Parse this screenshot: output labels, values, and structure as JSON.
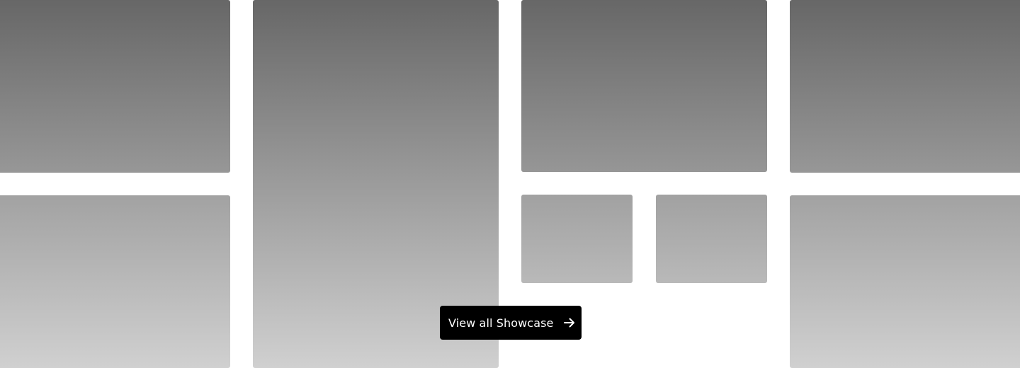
{
  "gallery": {
    "tiles": [
      {
        "kind": "image-placeholder"
      },
      {
        "kind": "image-placeholder"
      },
      {
        "kind": "image-placeholder"
      },
      {
        "kind": "image-placeholder"
      },
      {
        "kind": "image-placeholder"
      },
      {
        "kind": "image-placeholder"
      },
      {
        "kind": "image-placeholder"
      },
      {
        "kind": "image-placeholder"
      }
    ],
    "colors": {
      "tile_top": "#676767",
      "tile_bottom": "#d0d0d0",
      "background": "#ffffff"
    }
  },
  "cta": {
    "label": "View all Showcase",
    "icon": "arrow-right-icon",
    "background": "#000000",
    "text_color": "#ffffff"
  }
}
